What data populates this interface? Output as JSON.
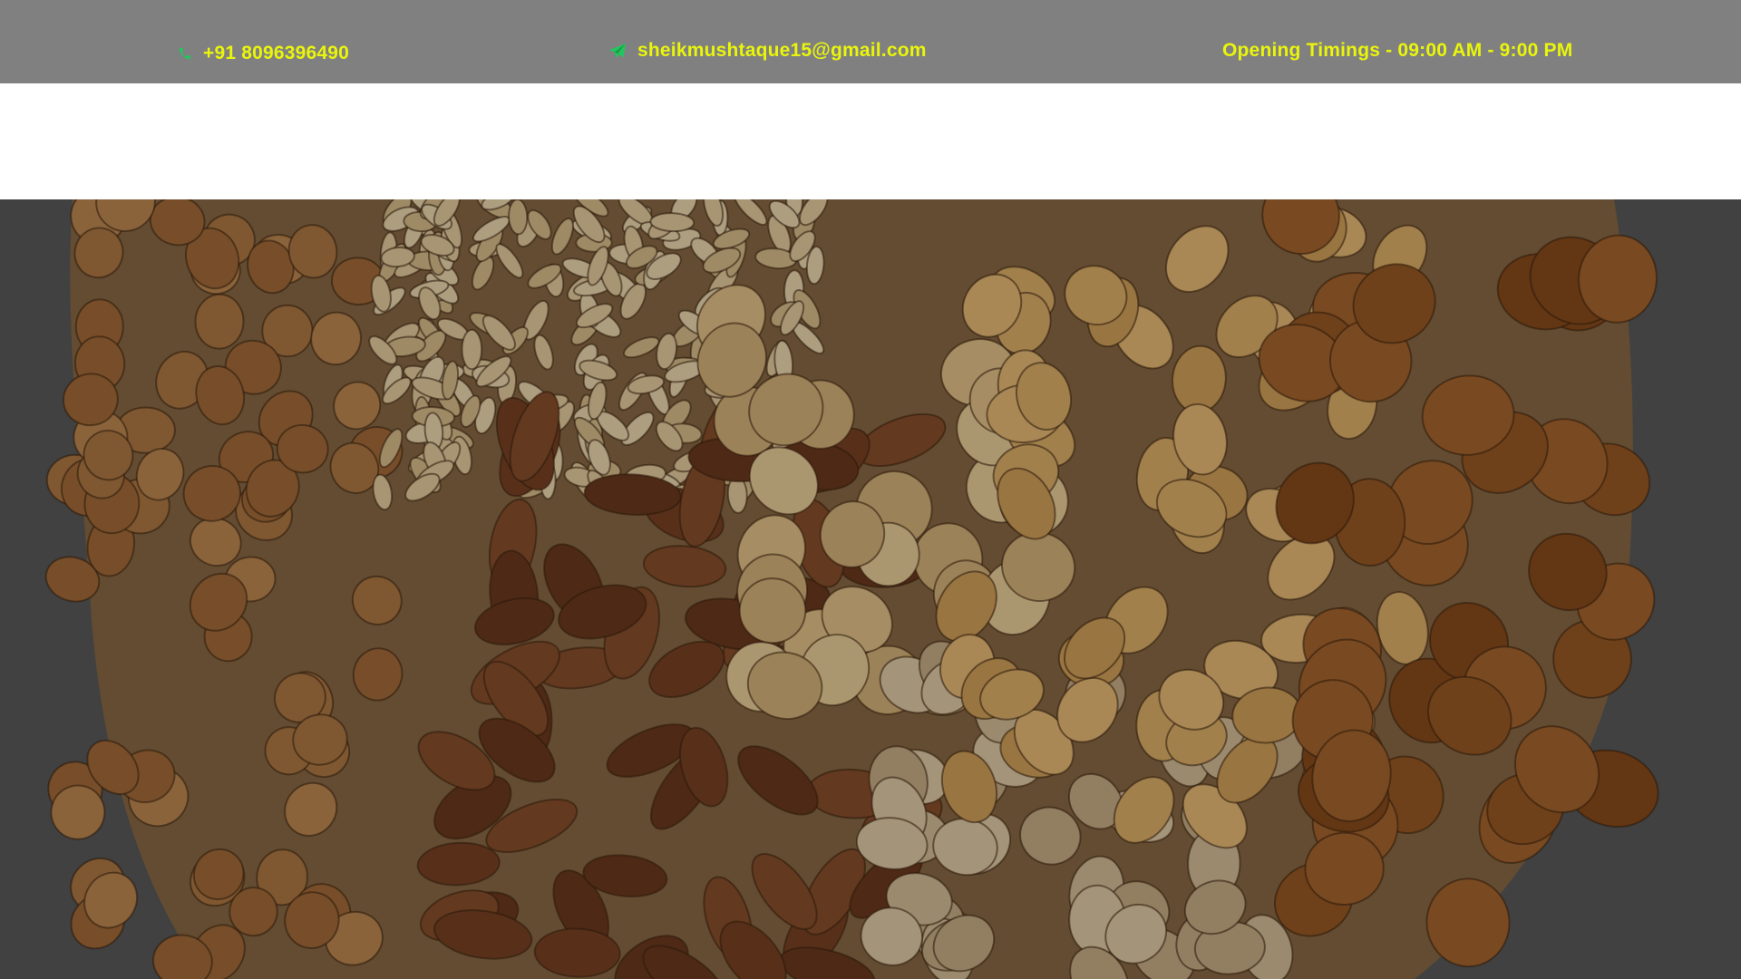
{
  "topbar": {
    "phone": "+91 8096396490",
    "email": "sheikmushtaque15@gmail.com",
    "timings": "Opening Timings - 09:00 AM - 9:00 PM",
    "phone_icon": "phone-icon",
    "email_icon": "paper-plane-icon",
    "text_color": "#E9F50B",
    "icon_color": "#22C55E",
    "background": "#808080"
  },
  "hero": {
    "image": "mixed-nuts-photo",
    "overlay_color": "#000000"
  }
}
